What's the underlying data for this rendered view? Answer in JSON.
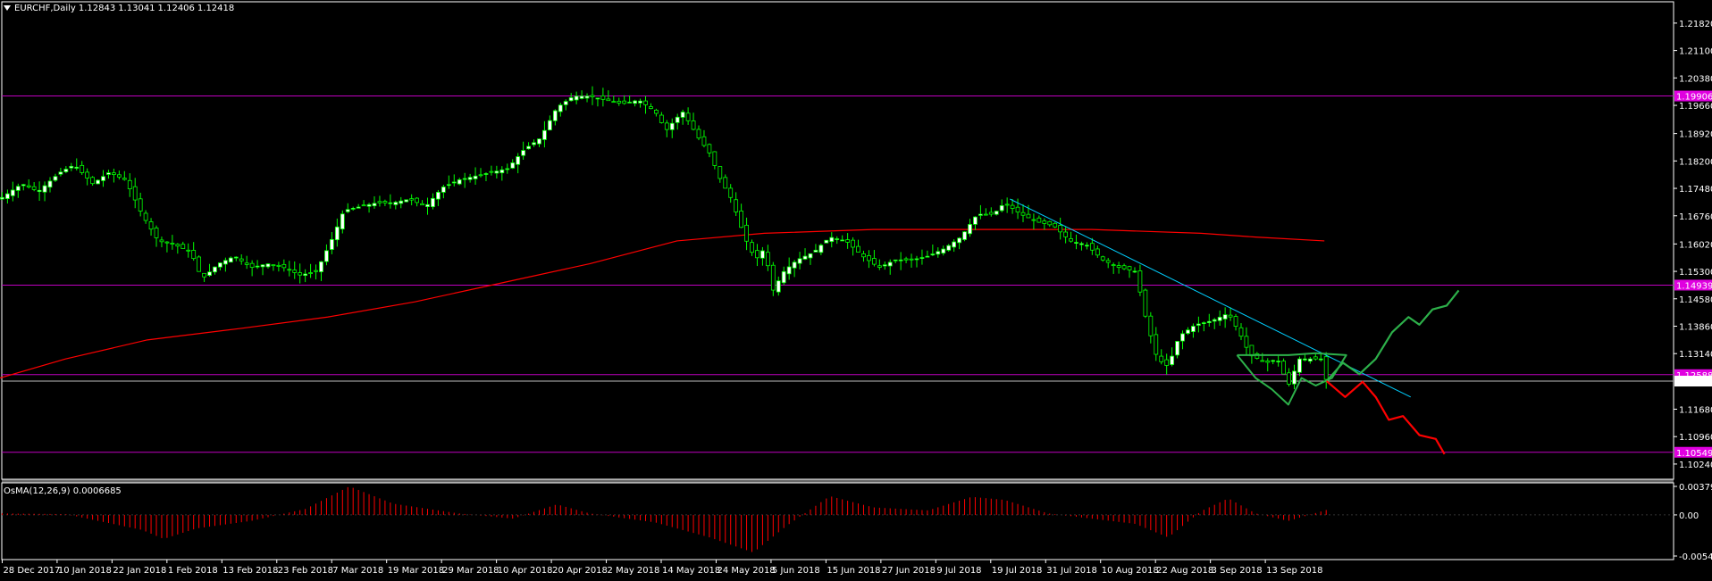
{
  "header": {
    "symbol": "EURCHF,Daily",
    "open": "1.12843",
    "high": "1.13041",
    "low": "1.12406",
    "close": "1.12418"
  },
  "indicator": {
    "name": "OsMA(12,26,9)",
    "value": "0.0006685"
  },
  "colors": {
    "background": "#000000",
    "bull_candle": "#ffffff",
    "bear_candle": "#000000",
    "candle_outline": "#00ff00",
    "moving_average": "#ff0000",
    "level_line": "#c000c0",
    "trendline": "#00cfff",
    "pattern": "#2db04a",
    "projection_up": "#2db04a",
    "projection_down": "#ff0000",
    "osma_bars": "#ff0000",
    "axis": "#ffffff"
  },
  "price_axis": {
    "min": 1.0984,
    "max": 1.2238,
    "ticks": [
      "1.21820",
      "1.21100",
      "1.20380",
      "1.19660",
      "1.18920",
      "1.18200",
      "1.17480",
      "1.16760",
      "1.16020",
      "1.15300",
      "1.14580",
      "1.13860",
      "1.13140",
      "1.11680",
      "1.10960",
      "1.10240"
    ],
    "level_labels": [
      "1.19906",
      "1.14939",
      "1.12588",
      "1.10549"
    ],
    "current_price_label": "1.12418"
  },
  "osma_axis": {
    "ticks": [
      "0.003793",
      "0.00",
      "-0.005472"
    ]
  },
  "time_axis": {
    "labels": [
      "28 Dec 2017",
      "10 Jan 2018",
      "22 Jan 2018",
      "1 Feb 2018",
      "13 Feb 2018",
      "23 Feb 2018",
      "7 Mar 2018",
      "19 Mar 2018",
      "29 Mar 2018",
      "10 Apr 2018",
      "20 Apr 2018",
      "2 May 2018",
      "14 May 2018",
      "24 May 2018",
      "5 Jun 2018",
      "15 Jun 2018",
      "27 Jun 2018",
      "9 Jul 2018",
      "19 Jul 2018",
      "31 Jul 2018",
      "10 Aug 2018",
      "22 Aug 2018",
      "3 Sep 2018",
      "13 Sep 2018"
    ]
  },
  "chart_data": {
    "type": "candlestick",
    "timeframe": "Daily",
    "horizontal_levels": [
      1.19906,
      1.14939,
      1.12588,
      1.10549
    ],
    "close_path": [
      [
        0,
        1.172
      ],
      [
        20,
        1.176
      ],
      [
        35,
        1.174
      ],
      [
        55,
        1.179
      ],
      [
        68,
        1.181
      ],
      [
        85,
        1.176
      ],
      [
        100,
        1.179
      ],
      [
        115,
        1.177
      ],
      [
        130,
        1.168
      ],
      [
        145,
        1.161
      ],
      [
        160,
        1.16
      ],
      [
        175,
        1.158
      ],
      [
        185,
        1.151
      ],
      [
        200,
        1.155
      ],
      [
        215,
        1.157
      ],
      [
        230,
        1.154
      ],
      [
        245,
        1.155
      ],
      [
        260,
        1.154
      ],
      [
        275,
        1.152
      ],
      [
        290,
        1.153
      ],
      [
        305,
        1.162
      ],
      [
        315,
        1.169
      ],
      [
        330,
        1.17
      ],
      [
        345,
        1.171
      ],
      [
        360,
        1.171
      ],
      [
        375,
        1.172
      ],
      [
        390,
        1.17
      ],
      [
        405,
        1.175
      ],
      [
        420,
        1.177
      ],
      [
        435,
        1.178
      ],
      [
        450,
        1.179
      ],
      [
        465,
        1.18
      ],
      [
        480,
        1.185
      ],
      [
        495,
        1.188
      ],
      [
        510,
        1.196
      ],
      [
        525,
        1.199
      ],
      [
        540,
        1.199
      ],
      [
        555,
        1.198
      ],
      [
        570,
        1.197
      ],
      [
        585,
        1.198
      ],
      [
        600,
        1.195
      ],
      [
        610,
        1.19
      ],
      [
        625,
        1.195
      ],
      [
        640,
        1.188
      ],
      [
        650,
        1.184
      ],
      [
        660,
        1.177
      ],
      [
        670,
        1.172
      ],
      [
        682,
        1.162
      ],
      [
        692,
        1.156
      ],
      [
        700,
        1.159
      ],
      [
        708,
        1.148
      ],
      [
        718,
        1.153
      ],
      [
        730,
        1.156
      ],
      [
        745,
        1.158
      ],
      [
        760,
        1.162
      ],
      [
        775,
        1.161
      ],
      [
        790,
        1.157
      ],
      [
        805,
        1.154
      ],
      [
        820,
        1.156
      ],
      [
        835,
        1.156
      ],
      [
        850,
        1.157
      ],
      [
        865,
        1.159
      ],
      [
        880,
        1.162
      ],
      [
        895,
        1.168
      ],
      [
        910,
        1.168
      ],
      [
        920,
        1.171
      ],
      [
        935,
        1.168
      ],
      [
        950,
        1.166
      ],
      [
        965,
        1.165
      ],
      [
        980,
        1.161
      ],
      [
        995,
        1.16
      ],
      [
        1010,
        1.156
      ],
      [
        1025,
        1.154
      ],
      [
        1040,
        1.153
      ],
      [
        1050,
        1.14
      ],
      [
        1060,
        1.13
      ],
      [
        1070,
        1.128
      ],
      [
        1080,
        1.136
      ],
      [
        1095,
        1.139
      ],
      [
        1110,
        1.14
      ],
      [
        1125,
        1.142
      ],
      [
        1135,
        1.137
      ],
      [
        1145,
        1.131
      ],
      [
        1160,
        1.129
      ],
      [
        1170,
        1.13
      ],
      [
        1180,
        1.123
      ],
      [
        1190,
        1.13
      ],
      [
        1200,
        1.13
      ],
      [
        1210,
        1.13
      ],
      [
        1215,
        1.1242
      ]
    ],
    "moving_average": [
      [
        0,
        1.125
      ],
      [
        60,
        1.13
      ],
      [
        135,
        1.135
      ],
      [
        220,
        1.138
      ],
      [
        300,
        1.141
      ],
      [
        380,
        1.145
      ],
      [
        460,
        1.15
      ],
      [
        540,
        1.155
      ],
      [
        620,
        1.161
      ],
      [
        700,
        1.163
      ],
      [
        800,
        1.164
      ],
      [
        900,
        1.164
      ],
      [
        1000,
        1.164
      ],
      [
        1100,
        1.163
      ],
      [
        1150,
        1.162
      ],
      [
        1213,
        1.161
      ]
    ],
    "trendline": [
      [
        925,
        1.172
      ],
      [
        1292,
        1.12
      ]
    ],
    "projection_up": [
      [
        1215,
        1.1242
      ],
      [
        1230,
        1.129
      ],
      [
        1245,
        1.126
      ],
      [
        1260,
        1.13
      ],
      [
        1275,
        1.137
      ],
      [
        1290,
        1.141
      ],
      [
        1300,
        1.139
      ],
      [
        1312,
        1.143
      ],
      [
        1325,
        1.144
      ],
      [
        1336,
        1.148
      ]
    ],
    "projection_down": [
      [
        1215,
        1.1242
      ],
      [
        1232,
        1.12
      ],
      [
        1248,
        1.124
      ],
      [
        1260,
        1.12
      ],
      [
        1272,
        1.114
      ],
      [
        1285,
        1.115
      ],
      [
        1300,
        1.11
      ],
      [
        1315,
        1.109
      ],
      [
        1323,
        1.105
      ]
    ],
    "pattern_outline": [
      [
        1133,
        1.131
      ],
      [
        1150,
        1.125
      ],
      [
        1165,
        1.122
      ],
      [
        1180,
        1.118
      ],
      [
        1192,
        1.125
      ],
      [
        1205,
        1.123
      ],
      [
        1220,
        1.125
      ],
      [
        1233,
        1.131
      ],
      [
        1205,
        1.1315
      ],
      [
        1180,
        1.131
      ],
      [
        1133,
        1.131
      ]
    ],
    "osma": {
      "ymin": -0.005472,
      "ymax": 0.003793,
      "values_sample": [
        [
          0,
          0.0002
        ],
        [
          60,
          0.0001
        ],
        [
          130,
          -0.002
        ],
        [
          150,
          -0.0032
        ],
        [
          180,
          -0.0018
        ],
        [
          230,
          -0.0008
        ],
        [
          280,
          0.0008
        ],
        [
          320,
          0.0038
        ],
        [
          360,
          0.0015
        ],
        [
          420,
          0.0002
        ],
        [
          470,
          -0.0005
        ],
        [
          510,
          0.0014
        ],
        [
          540,
          0.0002
        ],
        [
          600,
          -0.001
        ],
        [
          650,
          -0.003
        ],
        [
          690,
          -0.005
        ],
        [
          720,
          -0.0015
        ],
        [
          760,
          0.0025
        ],
        [
          800,
          0.001
        ],
        [
          850,
          0.0006
        ],
        [
          890,
          0.0024
        ],
        [
          920,
          0.002
        ],
        [
          960,
          0.0002
        ],
        [
          1000,
          -0.0005
        ],
        [
          1040,
          -0.0012
        ],
        [
          1070,
          -0.003
        ],
        [
          1100,
          0.0005
        ],
        [
          1125,
          0.0022
        ],
        [
          1150,
          0.0002
        ],
        [
          1180,
          -0.0008
        ],
        [
          1215,
          0.0006685
        ]
      ]
    }
  }
}
